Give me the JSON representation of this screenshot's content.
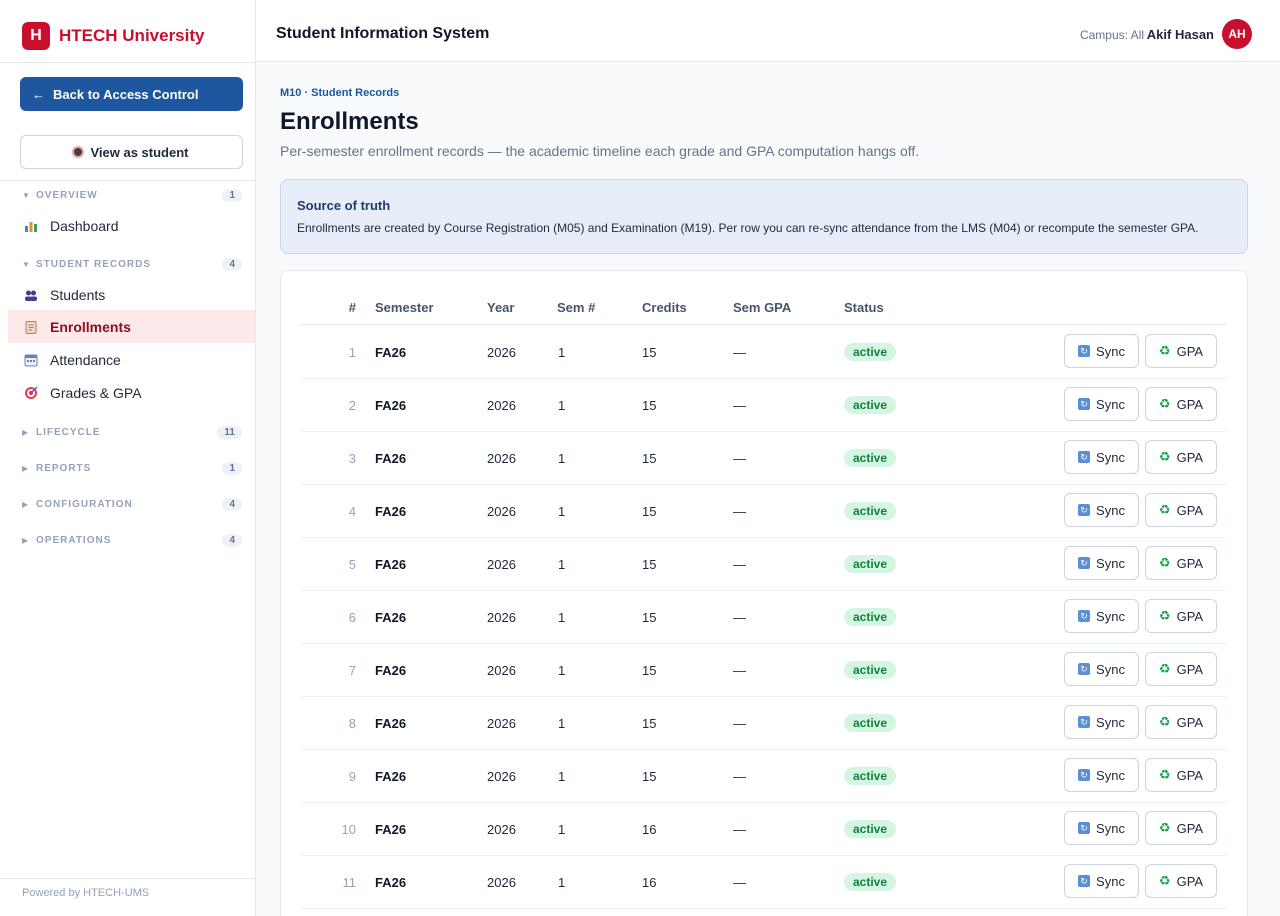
{
  "brand": {
    "logo_letter": "H",
    "name": "HTECH University",
    "color": "#c8102e"
  },
  "sidebar": {
    "back_label": "Back to Access Control",
    "back_arrow": "←",
    "view_as_label": "View as student",
    "sections": {
      "overview": {
        "label": "OVERVIEW",
        "count": "1"
      },
      "student_records": {
        "label": "STUDENT RECORDS",
        "count": "4"
      },
      "lifecycle": {
        "label": "LIFECYCLE",
        "count": "11"
      },
      "reports": {
        "label": "REPORTS",
        "count": "1"
      },
      "configuration": {
        "label": "CONFIGURATION",
        "count": "4"
      },
      "operations": {
        "label": "OPERATIONS",
        "count": "4"
      }
    },
    "items": {
      "dashboard": {
        "label": "Dashboard",
        "icon": "bar-chart-icon"
      },
      "students": {
        "label": "Students",
        "icon": "users-icon"
      },
      "enrollments": {
        "label": "Enrollments",
        "icon": "clipboard-icon",
        "active": true
      },
      "attendance": {
        "label": "Attendance",
        "icon": "calendar-icon"
      },
      "grades": {
        "label": "Grades & GPA",
        "icon": "target-icon"
      }
    },
    "footer": "Powered by HTECH-UMS"
  },
  "topbar": {
    "title": "Student Information System",
    "campus": "Campus: All",
    "user_name": "Akif Hasan",
    "avatar_initials": "AH"
  },
  "main": {
    "breadcrumb": "M10 · Student Records",
    "title": "Enrollments",
    "subtitle": "Per-semester enrollment records — the academic timeline each grade and GPA computation hangs off.",
    "info": {
      "title": "Source of truth",
      "text": "Enrollments are created by Course Registration (M05) and Examination (M19). Per row you can re-sync attendance from the LMS (M04) or recompute the semester GPA."
    },
    "table": {
      "columns": [
        "#",
        "Semester",
        "Year",
        "Sem #",
        "Credits",
        "Sem GPA",
        "Status"
      ],
      "sync_label": "Sync",
      "gpa_label": "GPA",
      "rows": [
        {
          "n": "1",
          "semester": "FA26",
          "year": "2026",
          "sem": "1",
          "credits": "15",
          "gpa": "—",
          "status": "active"
        },
        {
          "n": "2",
          "semester": "FA26",
          "year": "2026",
          "sem": "1",
          "credits": "15",
          "gpa": "—",
          "status": "active"
        },
        {
          "n": "3",
          "semester": "FA26",
          "year": "2026",
          "sem": "1",
          "credits": "15",
          "gpa": "—",
          "status": "active"
        },
        {
          "n": "4",
          "semester": "FA26",
          "year": "2026",
          "sem": "1",
          "credits": "15",
          "gpa": "—",
          "status": "active"
        },
        {
          "n": "5",
          "semester": "FA26",
          "year": "2026",
          "sem": "1",
          "credits": "15",
          "gpa": "—",
          "status": "active"
        },
        {
          "n": "6",
          "semester": "FA26",
          "year": "2026",
          "sem": "1",
          "credits": "15",
          "gpa": "—",
          "status": "active"
        },
        {
          "n": "7",
          "semester": "FA26",
          "year": "2026",
          "sem": "1",
          "credits": "15",
          "gpa": "—",
          "status": "active"
        },
        {
          "n": "8",
          "semester": "FA26",
          "year": "2026",
          "sem": "1",
          "credits": "15",
          "gpa": "—",
          "status": "active"
        },
        {
          "n": "9",
          "semester": "FA26",
          "year": "2026",
          "sem": "1",
          "credits": "15",
          "gpa": "—",
          "status": "active"
        },
        {
          "n": "10",
          "semester": "FA26",
          "year": "2026",
          "sem": "1",
          "credits": "16",
          "gpa": "—",
          "status": "active"
        },
        {
          "n": "11",
          "semester": "FA26",
          "year": "2026",
          "sem": "1",
          "credits": "16",
          "gpa": "—",
          "status": "active"
        }
      ]
    }
  },
  "colors": {
    "primary": "#1e56a0",
    "accent": "#c8102e",
    "active_bg": "#fde8ea",
    "status_active": "#15803d"
  }
}
